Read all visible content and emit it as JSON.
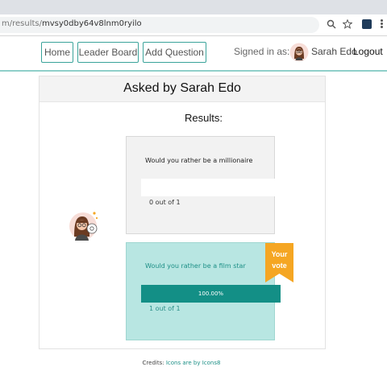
{
  "browser": {
    "url_host_fragment": "m/results/",
    "url_path": "mvsy0dby64v8lnm0ryilo"
  },
  "nav": {
    "home": "Home",
    "leader_board": "Leader Board",
    "add_question": "Add Question",
    "signed_in_label": "Signed in as:",
    "user_name": "Sarah Edo",
    "logout": "Logout"
  },
  "poll": {
    "title": "Asked by Sarah Edo",
    "results_heading": "Results:",
    "options": [
      {
        "text": "Would you rather be a millionaire",
        "votes": 0,
        "total": 1,
        "count_text": "0 out of 1",
        "percent": 0,
        "percent_text": "",
        "is_user_vote": false
      },
      {
        "text": "Would you rather be a film star",
        "votes": 1,
        "total": 1,
        "count_text": "1 out of 1",
        "percent": 100,
        "percent_text": "100.00%",
        "is_user_vote": true
      }
    ],
    "vote_badge_line1": "Your",
    "vote_badge_line2": "vote"
  },
  "footer": {
    "credits_label": "Credits:",
    "credits_link": "Icons are by Icons8"
  },
  "colors": {
    "accent": "#138f86",
    "nav_border": "#3aa39a",
    "voted_background": "#b8e6e2",
    "badge": "#f5a623"
  },
  "icons": [
    "search-icon",
    "star-icon",
    "extension-icon",
    "menu-icon",
    "avatar"
  ]
}
